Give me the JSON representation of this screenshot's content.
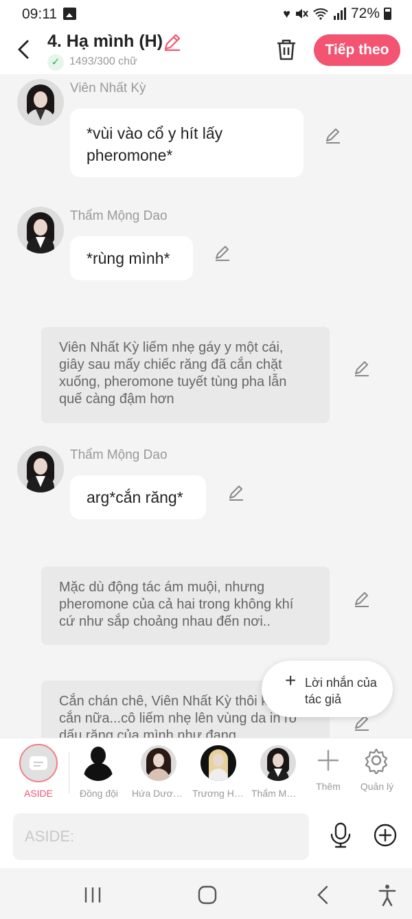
{
  "status": {
    "time": "09:11",
    "battery": "72%",
    "icons": [
      "gallery-icon",
      "heart-icon",
      "mute-icon",
      "wifi-icon",
      "signal-icon",
      "battery-icon"
    ]
  },
  "header": {
    "title": "4. Hạ mình (H)",
    "word_count": "1493/300 chữ",
    "next_label": "Tiếp theo"
  },
  "messages": [
    {
      "type": "character",
      "name": "Viên Nhất Kỳ",
      "text": "*vùi vào cổ y hít lấy pheromone*"
    },
    {
      "type": "character",
      "name": "Thẩm Mộng Dao",
      "text": "*rùng mình*"
    },
    {
      "type": "narration",
      "text": "Viên Nhất Kỳ liếm nhẹ gáy y một cái, giây sau mấy chiếc răng đã cắn chặt xuống, pheromone tuyết tùng pha lẫn quế càng đậm hơn"
    },
    {
      "type": "character",
      "name": "Thẩm Mộng Dao",
      "text": "arg*cắn răng*"
    },
    {
      "type": "narration",
      "text": "Mặc dù động tác ám muội, nhưng pheromone của cả hai trong không khí cứ như sắp choảng nhau đến nơi.."
    },
    {
      "type": "narration",
      "text": "Cắn chán chê, Viên Nhất Kỳ thôi không cắn nữa...cô liếm nhẹ lên vùng da in rõ dấu răng của mình như đang"
    }
  ],
  "author_note": {
    "label": "Lời nhắn của tác giả"
  },
  "characters_bar": [
    {
      "label": "ASIDE"
    },
    {
      "label": "Đồng đội"
    },
    {
      "label": "Hứa Dương Ngọc Trác"
    },
    {
      "label": "Trương Hân"
    },
    {
      "label": "Thẩm Mộng Dao"
    },
    {
      "label": "Thêm"
    },
    {
      "label": "Quản lý"
    }
  ],
  "input": {
    "placeholder": "ASIDE:"
  },
  "colors": {
    "accent": "#f25471",
    "bubble": "#ffffff",
    "narration_bg": "#e9e9e9",
    "background": "#f4f4f4"
  }
}
